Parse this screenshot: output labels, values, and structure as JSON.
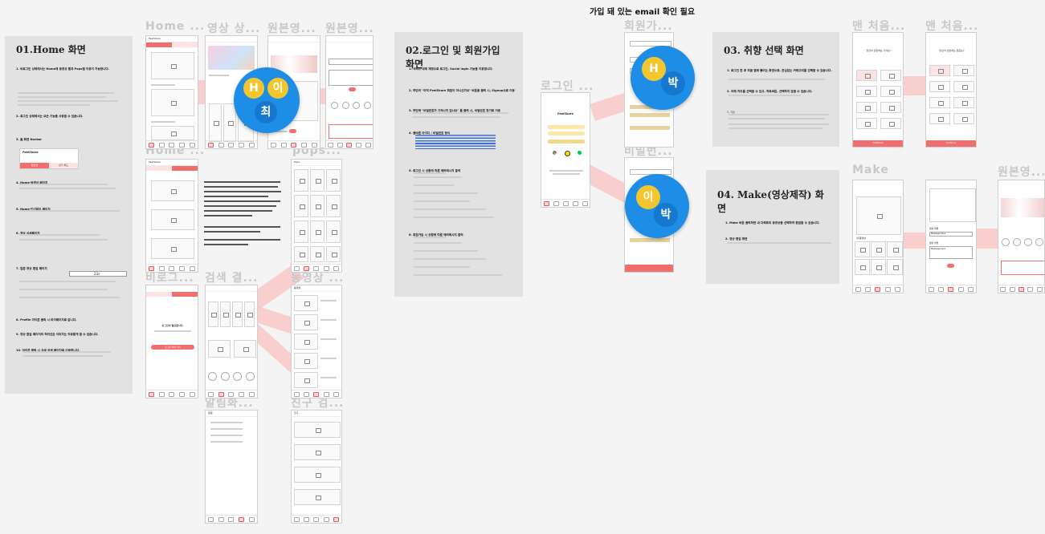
{
  "note_top": "가입 돼 있는 email 확인 필요",
  "panels": {
    "home": {
      "title": "01.Home 화면",
      "lines": [
        "1. 비로그인 상태에서는 Home에 동영상 탭과 Pops탭 이용이 가능합니다.",
        "2. 로그인 상태에서는 모든 기능을 사용할 수 있습니다.",
        "3. 홈 화면 Navbar",
        "4. Home-동영상 페이지",
        "5. Home-인기피드 페이지",
        "6. 영상 상세페이지",
        "7. 원본 영상 편집 페이지",
        "8. Profile 아이콘 클릭 시 마이페이지로 갑니다.",
        "9. 영상 편집 페이지의 하위선은 이미지는 자유롭게 할 수 있습니다.",
        "10. 아이콘 클릭 시 상세 검색 페이지로 이동합니다."
      ],
      "mini_logo": "FeelShare",
      "mini_tab1": "동영상",
      "mini_tab2": "인기 피드",
      "timer": "23s"
    },
    "login": {
      "title": "02.로그인 및 회원가입 화면",
      "lines": [
        "1. 서비스 내에 계정으로 로그인, Social login 기능을 이용합니다.",
        "2. 하단의 \"아직 FeelShare 회원이 아니신가요\" 버튼을 클릭 시, Signup으로 이동",
        "3. 하단에 \"비밀번호가 기억나지 않나요\" 를 클릭 시, 비밀번호 찾기로 이동",
        "4. 올바른 아이디 / 비밀번호 형식",
        "5. 로그인 시 상황에 따른 에러메시지 출력",
        "6. 회원가입 시 상황에 따른 에러메시지 출력"
      ]
    },
    "taste": {
      "title": "03. 취향 선택 화면",
      "lines": [
        "1. 로그인 한 후 처음 앱에 들어는 화면으로, 관심있는 카테고리를 선택할 수 있습니다.",
        "2. 아래 카드를 선택할 수 있고, 하트버튼, 선택하지 않을 수 있습니다.",
        "3. 기능"
      ]
    },
    "make": {
      "title": "04. Make(영상제작) 화면",
      "lines": [
        "1. Make 버튼 클릭하면 내 디렉토리 동영상을 선택하여 편집할 수 있습니다.",
        "2. 영상 편집 화면"
      ]
    }
  },
  "frame_labels": [
    "Home ...",
    "영상 상...",
    "원본영...",
    "원본영...",
    "Home ...",
    "pops...",
    "비로그...",
    "검색 결...",
    "동영상 ...",
    "알림화...",
    "친구 검...",
    "로그인 ...",
    "회원가...",
    "비밀번...",
    "맨 처음...",
    "맨 처음...",
    "Make",
    "원본영..."
  ],
  "phones": {
    "home1_title": "FeelShare",
    "pops_title": "Pops",
    "notif_title": "알림",
    "friends_title": "친구",
    "video_title": "동영상",
    "login_logo": "FeelShare",
    "signup_btn": "회원가입 완료",
    "nologin_msg": "로그인이 필요합니다.",
    "nologin_btn": "로그인 하러 가기",
    "taste_q1": "당신이 선호하는 가사는?",
    "taste_q2": "당신이 선호하는 장르는?",
    "taste_btn": "FeelShare",
    "make_label": "내 동영상",
    "edit_title_label": "영상 제목",
    "edit_title_value": "Message here",
    "edit_body_label": "영상 설명",
    "edit_body_value": "Message here"
  },
  "avatars": {
    "group1": [
      "H",
      "이",
      "최"
    ],
    "group2": [
      "H",
      "박"
    ],
    "group3": [
      "이",
      "박"
    ]
  },
  "colors": {
    "accent": "#f26d6d",
    "avatar_bg": "#1e8de6",
    "avatar_yellow": "#f4c62d",
    "connector": "#f8c7c7"
  }
}
